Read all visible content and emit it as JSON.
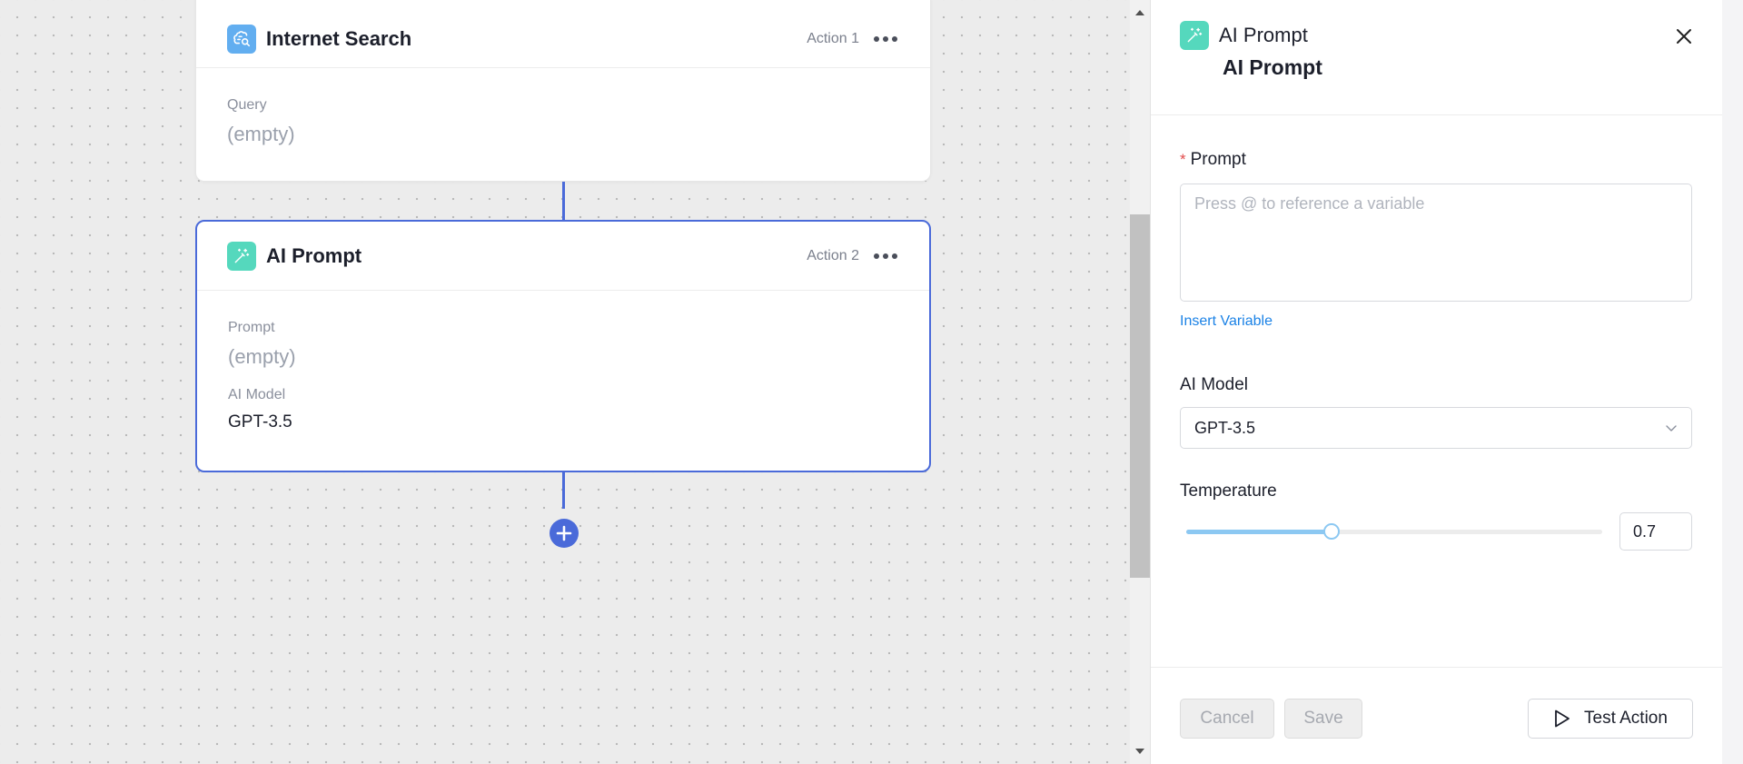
{
  "canvas": {
    "nodes": [
      {
        "title": "Internet Search",
        "action_label": "Action 1",
        "icon": "brain-search-icon",
        "fields": [
          {
            "label": "Query",
            "value": "(empty)"
          }
        ]
      },
      {
        "title": "AI Prompt",
        "action_label": "Action 2",
        "icon": "sparkle-wand-icon",
        "fields": [
          {
            "label": "Prompt",
            "value": "(empty)"
          },
          {
            "label": "AI Model",
            "value": "GPT-3.5"
          }
        ]
      }
    ],
    "add_step_icon": "plus-circle-icon"
  },
  "panel": {
    "title": "AI Prompt",
    "subtitle": "AI Prompt",
    "close_icon": "close-icon",
    "prompt": {
      "label": "Prompt",
      "required_mark": "*",
      "placeholder": "Press @ to reference a variable",
      "value": ""
    },
    "insert_variable_label": "Insert Variable",
    "model": {
      "label": "AI Model",
      "selected": "GPT-3.5"
    },
    "temperature": {
      "label": "Temperature",
      "value": "0.7",
      "fraction": 0.35
    },
    "footer": {
      "cancel_label": "Cancel",
      "save_label": "Save",
      "test_label": "Test Action"
    }
  },
  "colors": {
    "accent": "#4a6ad9",
    "link": "#1b82e6",
    "search_icon_bg": "#62aef0",
    "ai_icon_bg": "#55d8bd",
    "slider": "#8cc8f2",
    "required": "#e24b4b"
  }
}
